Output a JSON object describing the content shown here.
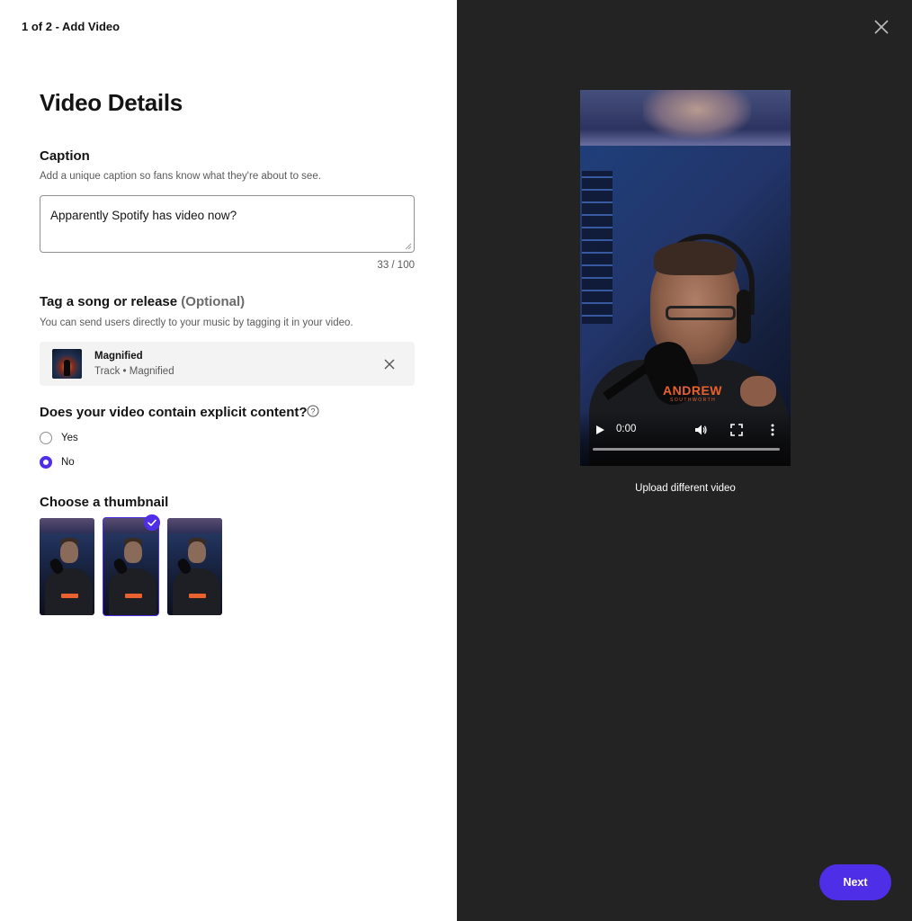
{
  "header": {
    "step": "1 of 2 - Add Video"
  },
  "page": {
    "title": "Video Details"
  },
  "caption": {
    "title": "Caption",
    "description": "Add a unique caption so fans know what they're about to see.",
    "value": "Apparently Spotify has video now?",
    "counter": "33 / 100"
  },
  "tag": {
    "title": "Tag a song or release",
    "optional": "(Optional)",
    "description": "You can send users directly to your music by tagging it in your video.",
    "track": {
      "name": "Magnified",
      "subtitle": "Track • Magnified"
    }
  },
  "explicit": {
    "question": "Does your video contain explicit content?",
    "options": [
      {
        "label": "Yes",
        "checked": false
      },
      {
        "label": "No",
        "checked": true
      }
    ]
  },
  "thumbnail": {
    "title": "Choose a thumbnail",
    "selected_index": 1
  },
  "player": {
    "time": "0:00",
    "logo": "ANDREW",
    "logo_sub": "SOUTHWORTH"
  },
  "actions": {
    "upload_label": "Upload different video",
    "next_label": "Next"
  },
  "colors": {
    "accent": "#4f2ee8",
    "panel_dark": "#232323"
  },
  "icons": [
    "close-icon",
    "remove-icon",
    "help-icon",
    "play-icon",
    "volume-icon",
    "fullscreen-icon",
    "more-vertical-icon",
    "check-icon"
  ]
}
